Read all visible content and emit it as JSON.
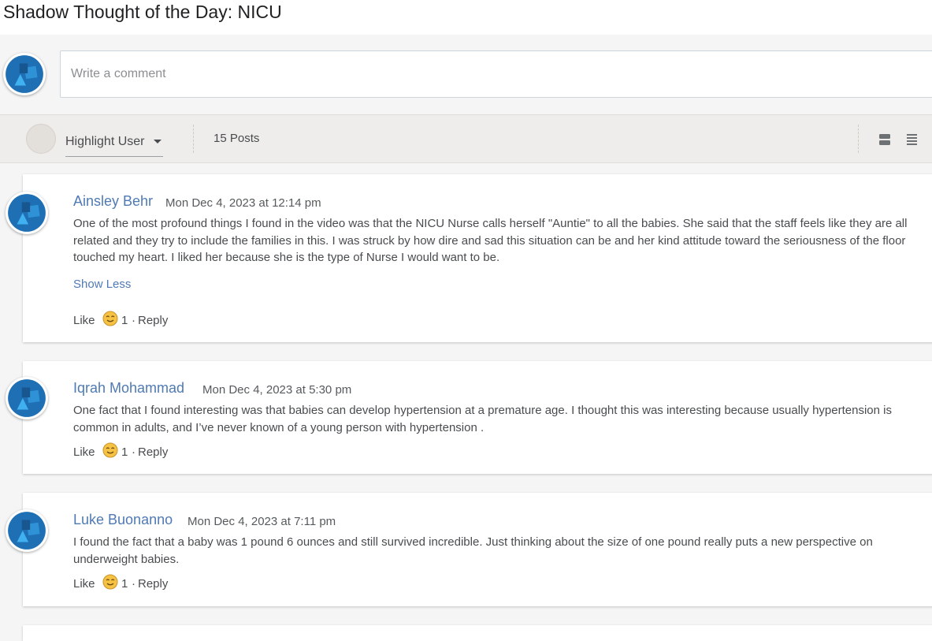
{
  "page": {
    "title": "Shadow Thought of the Day: NICU"
  },
  "composer": {
    "placeholder": "Write a comment"
  },
  "toolbar": {
    "highlight_user_label": "Highlight User",
    "posts_count": "15 Posts",
    "view_buttons": [
      "card-view-icon",
      "list-view-icon"
    ]
  },
  "posts": [
    {
      "author": "Ainsley Behr",
      "date": "Mon Dec 4, 2023 at 12:14 pm",
      "body": "One of the most profound things I found in the video was that the NICU Nurse calls herself \"Auntie\" to all the babies. She said that the staff feels like they are all related and they try to include the families in this. I was struck by how dire and sad this situation can be and her kind attitude toward the seriousness of the floor touched my heart. I liked her because she is the type of Nurse I would want to be.",
      "show_less": "Show Less",
      "like_label": "Like",
      "reaction_count": "1",
      "separator": "·",
      "reply_label": "Reply"
    },
    {
      "author": "Iqrah Mohammad",
      "date": "Mon Dec 4, 2023 at 5:30 pm",
      "body": "One fact that I found interesting was that babies can develop hypertension at a premature age. I thought this was interesting because usually hypertension is common in adults, and I’ve never known of a young person with hypertension .",
      "like_label": "Like",
      "reaction_count": "1",
      "separator": "·",
      "reply_label": "Reply"
    },
    {
      "author": "Luke Buonanno",
      "date": "Mon Dec 4, 2023 at 7:11 pm",
      "body": "I found the fact that a baby was 1 pound 6 ounces and still survived incredible. Just thinking about the size of one pound really puts a new perspective on underweight babies.",
      "like_label": "Like",
      "reaction_count": "1",
      "separator": "·",
      "reply_label": "Reply"
    }
  ],
  "colors": {
    "link": "#4f7ab3",
    "text": "#494c4e",
    "toolbar_bg": "#efedeb",
    "avatar_blue": "#1f6fb5"
  }
}
